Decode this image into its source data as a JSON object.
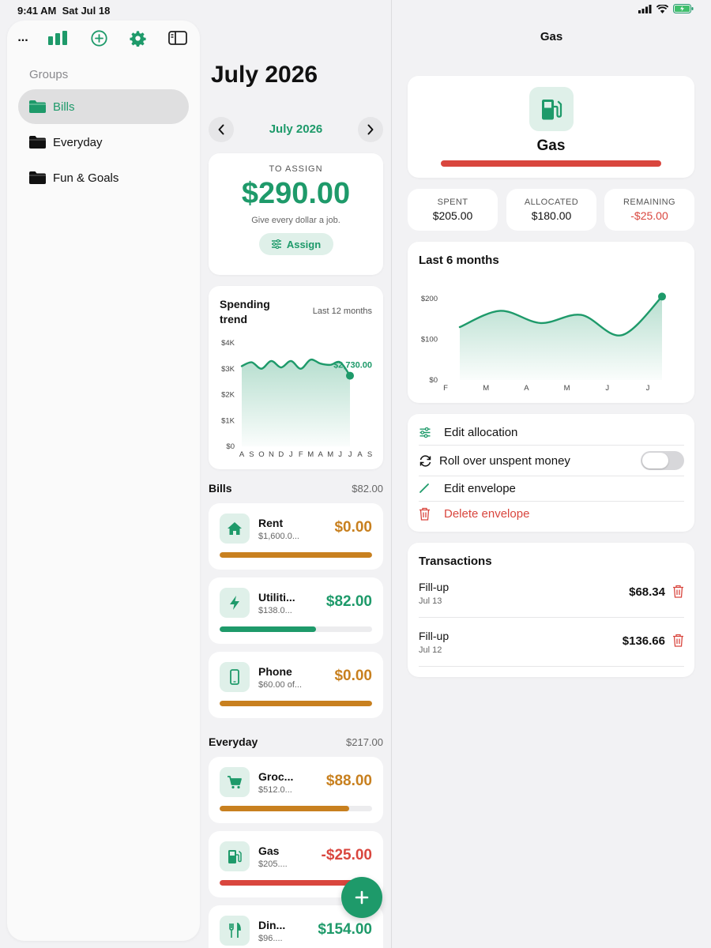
{
  "status_bar": {
    "time": "9:41 AM",
    "date": "Sat Jul 18"
  },
  "sidebar": {
    "toolbar": {
      "more_label": "...",
      "icons": [
        "chart-bars-icon",
        "plus-circle-icon",
        "gear-icon",
        "sidebar-toggle-icon"
      ]
    },
    "groups_label": "Groups",
    "items": [
      {
        "label": "Bills",
        "active": true
      },
      {
        "label": "Everyday",
        "active": false
      },
      {
        "label": "Fun & Goals",
        "active": false
      }
    ]
  },
  "main": {
    "title": "July 2026",
    "month_nav": {
      "label": "July 2026"
    },
    "assign": {
      "caption": "TO ASSIGN",
      "amount": "$290.00",
      "subtitle": "Give every dollar a job.",
      "button_label": "Assign"
    },
    "trend": {
      "title": "Spending trend",
      "range": "Last 12 months",
      "callout": "$2,730.00"
    },
    "sections": [
      {
        "name": "Bills",
        "total": "$82.00"
      },
      {
        "name": "Everyday",
        "total": "$217.00"
      }
    ],
    "envelopes": [
      {
        "name": "Rent",
        "sub": "$1,600.0...",
        "amount": "$0.00",
        "status": "orange",
        "progress": 1.0,
        "icon": "house-icon"
      },
      {
        "name": "Utiliti...",
        "sub": "$138.0...",
        "amount": "$82.00",
        "status": "green",
        "progress": 0.63,
        "icon": "bolt-icon"
      },
      {
        "name": "Phone",
        "sub": "$60.00 of...",
        "amount": "$0.00",
        "status": "orange",
        "progress": 1.0,
        "icon": "phone-icon"
      },
      {
        "name": "Groc...",
        "sub": "$512.0...",
        "amount": "$88.00",
        "status": "orange",
        "progress": 0.85,
        "icon": "cart-icon"
      },
      {
        "name": "Gas",
        "sub": "$205....",
        "amount": "-$25.00",
        "status": "red",
        "progress": 1.0,
        "icon": "fuel-icon"
      },
      {
        "name": "Din...",
        "sub": "$96....",
        "amount": "$154.00",
        "status": "green",
        "progress": 0.4,
        "icon": "fork-knife-icon"
      }
    ]
  },
  "detail": {
    "title": "Gas",
    "hero_name": "Gas",
    "stats": [
      {
        "label": "SPENT",
        "value": "$205.00",
        "color": "#111111"
      },
      {
        "label": "ALLOCATED",
        "value": "$180.00",
        "color": "#111111"
      },
      {
        "label": "REMAINING",
        "value": "-$25.00",
        "color": "#d9463e"
      }
    ],
    "months_title": "Last 6 months",
    "actions": {
      "edit_allocation": "Edit allocation",
      "rollover": "Roll over unspent money",
      "rollover_on": false,
      "edit_envelope": "Edit envelope",
      "delete_envelope": "Delete envelope"
    },
    "transactions_title": "Transactions",
    "transactions": [
      {
        "name": "Fill-up",
        "date": "Jul 13",
        "amount": "$68.34"
      },
      {
        "name": "Fill-up",
        "date": "Jul 12",
        "amount": "$136.66"
      }
    ]
  },
  "colors": {
    "green": "#1e9a6a",
    "orange": "#c8801f",
    "red": "#d9463e",
    "track": "#ececee"
  },
  "chart_data": [
    {
      "type": "area",
      "title": "Spending trend",
      "x": [
        "A",
        "S",
        "O",
        "N",
        "D",
        "J",
        "F",
        "M",
        "A",
        "M",
        "J",
        "J",
        "A",
        "S"
      ],
      "y_ticks": [
        "$0",
        "$1K",
        "$2K",
        "$3K",
        "$4K"
      ],
      "ylim": [
        0,
        4000
      ],
      "series": [
        {
          "values": [
            3100,
            3250,
            3000,
            3300,
            3050,
            3300,
            3000,
            3350,
            3200,
            3150,
            3250,
            2730
          ]
        }
      ],
      "highlight": {
        "label": "$2,730.00",
        "value": 2730
      }
    },
    {
      "type": "area",
      "title": "Last 6 months",
      "x": [
        "F",
        "M",
        "A",
        "M",
        "J",
        "J"
      ],
      "y_ticks": [
        "$0",
        "$100",
        "$200"
      ],
      "ylim": [
        0,
        200
      ],
      "series": [
        {
          "values": [
            130,
            170,
            140,
            160,
            110,
            205
          ]
        }
      ]
    }
  ]
}
